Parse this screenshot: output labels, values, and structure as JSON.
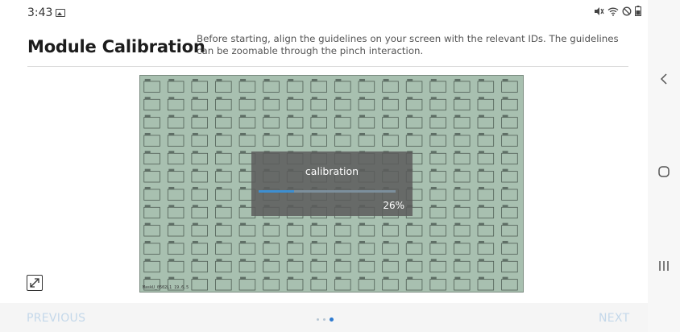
{
  "status": {
    "time": "3:43",
    "icons": [
      "image-icon",
      "mute-icon",
      "wifi-icon",
      "dnd-icon",
      "battery-icon"
    ]
  },
  "header": {
    "title": "Module Calibration",
    "description": "Before starting, align the guidelines on your screen with the relevant IDs. The guidelines can be zoomable through the pinch interaction."
  },
  "calibration": {
    "label": "calibration",
    "progress_text": "26%",
    "progress": 0.26
  },
  "footer": {
    "previous_label": "PREVIOUS",
    "next_label": "NEXT",
    "page_count": 3,
    "active_page": 3
  },
  "nav": {
    "icons": [
      "back-icon",
      "home-icon",
      "recents-icon"
    ]
  },
  "colors": {
    "accent": "#2e7ad0",
    "footer_text": "#c4d8ea",
    "overlay": "#5c5c5c"
  }
}
